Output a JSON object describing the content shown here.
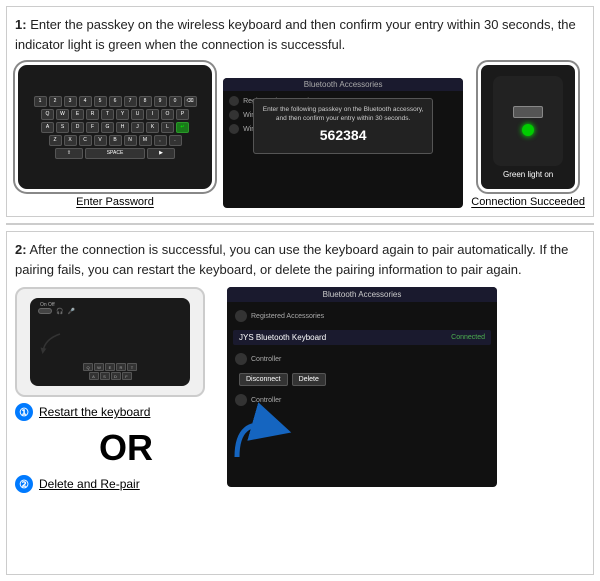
{
  "section1": {
    "step": "1:",
    "description": "Enter the passkey on the wireless keyboard and then confirm your entry within 30 seconds, the  indicator light is green when the connection is successful.",
    "tv_title": "Bluetooth Accessories",
    "tv_menu_items": [
      "Registered Accessories",
      "Wireless Controller",
      "Wireless"
    ],
    "dialog_text": "Enter the following passkey on the Bluetooth accessory, and then confirm your entry within 30 seconds.",
    "dialog_code": "562384",
    "left_caption": "Enter Password",
    "right_caption": "Connection Succeeded",
    "green_label": "Green light on"
  },
  "section2": {
    "step": "2:",
    "description": "After the connection is successful, you can use the keyboard again to pair automatically. If the pairing fails, you can restart the keyboard, or delete the pairing information to pair again.",
    "tv2_title": "Bluetooth Accessories",
    "tv2_device": "JYS Bluetooth Keyboard",
    "tv2_connected": "Connected",
    "tv2_btn1": "Disconnect",
    "tv2_btn2": "Delete",
    "option1": "Restart the keyboard",
    "or_label": "OR",
    "option2": "Delete and Re-pair"
  },
  "icons": {
    "circled1": "①",
    "circled2": "②"
  }
}
